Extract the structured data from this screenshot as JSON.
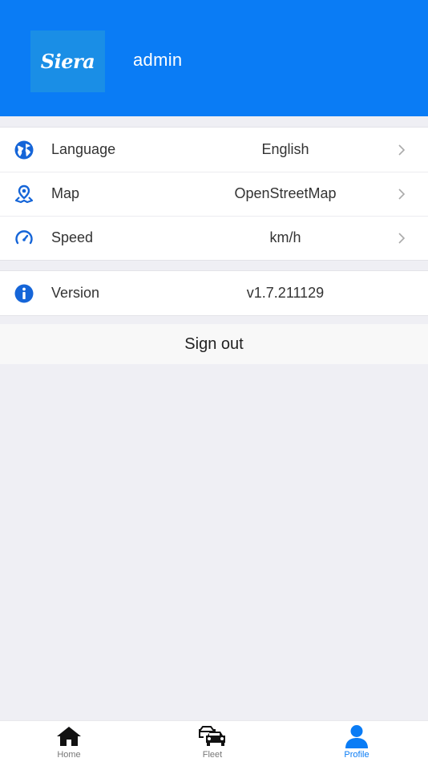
{
  "header": {
    "logo_text": "Siera",
    "username": "admin"
  },
  "settings": [
    {
      "label": "Language",
      "value": "English",
      "icon": "globe-icon"
    },
    {
      "label": "Map",
      "value": "OpenStreetMap",
      "icon": "map-pin-icon"
    },
    {
      "label": "Speed",
      "value": "km/h",
      "icon": "speedometer-icon"
    }
  ],
  "info": {
    "label": "Version",
    "value": "v1.7.211129",
    "icon": "info-icon"
  },
  "signout_label": "Sign out",
  "tabs": [
    {
      "label": "Home",
      "icon": "home-icon"
    },
    {
      "label": "Fleet",
      "icon": "fleet-icon"
    },
    {
      "label": "Profile",
      "icon": "profile-icon",
      "active": true
    }
  ],
  "colors": {
    "accent": "#0a7cf5",
    "icon_blue": "#1565d8",
    "background": "#efeff4"
  }
}
